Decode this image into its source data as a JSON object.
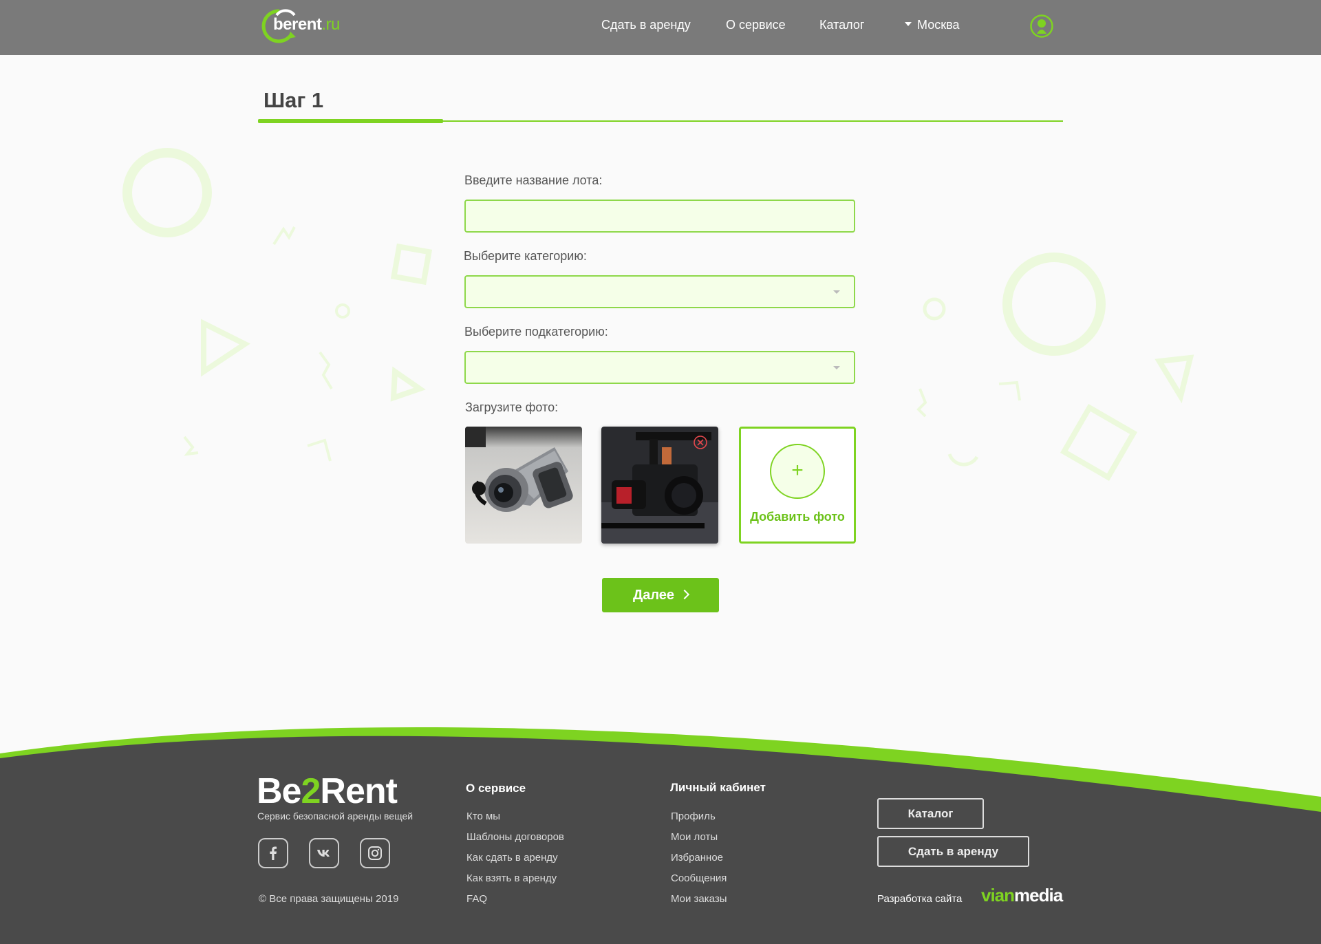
{
  "header": {
    "logo": {
      "part1": "be",
      "part2": "rent",
      "part3": ".ru"
    },
    "nav": [
      "Сдать в аренду",
      "О сервисе",
      "Каталог"
    ],
    "city": "Москва",
    "user_icon": "user-icon"
  },
  "step": {
    "title": "Шаг 1",
    "progress": 0.23
  },
  "form": {
    "lot_name_label": "Введите название лота:",
    "lot_name_value": "",
    "category_label": "Выберите категорию:",
    "category_value": "",
    "subcategory_label": "Выберите подкатегорию:",
    "subcategory_value": "",
    "photo_label": "Загрузите фото:",
    "photos": [
      "camcorder-photo",
      "cinema-camera-photo"
    ],
    "add_photo_label": "Добавить фото",
    "add_photo_icon": "+",
    "next_label": "Далее"
  },
  "footer": {
    "brand": {
      "be": "Be",
      "two": "2",
      "rent": "Rent"
    },
    "tagline": "Сервис безопасной аренды вещей",
    "social": [
      "facebook-icon",
      "vk-icon",
      "instagram-icon"
    ],
    "copyright": "© Все права защищены 2019",
    "about": {
      "heading": "О сервисе",
      "links": [
        "Кто мы",
        "Шаблоны договоров",
        "Как сдать в аренду",
        "Как взять в аренду",
        "FAQ"
      ]
    },
    "account": {
      "heading": "Личный кабинет",
      "links": [
        "Профиль",
        "Мои лоты",
        "Избранное",
        "Сообщения",
        "Мои заказы"
      ]
    },
    "buttons": {
      "catalog": "Каталог",
      "rent_out": "Сдать в аренду"
    },
    "dev_label": "Разработка сайта",
    "dev_brand": {
      "part1": "vian",
      "part2": "media"
    }
  },
  "colors": {
    "accent": "#7ed321",
    "header_bg": "#7a7a7a",
    "footer_bg": "#4a4a4a",
    "field_bg": "#f5ffe8"
  }
}
